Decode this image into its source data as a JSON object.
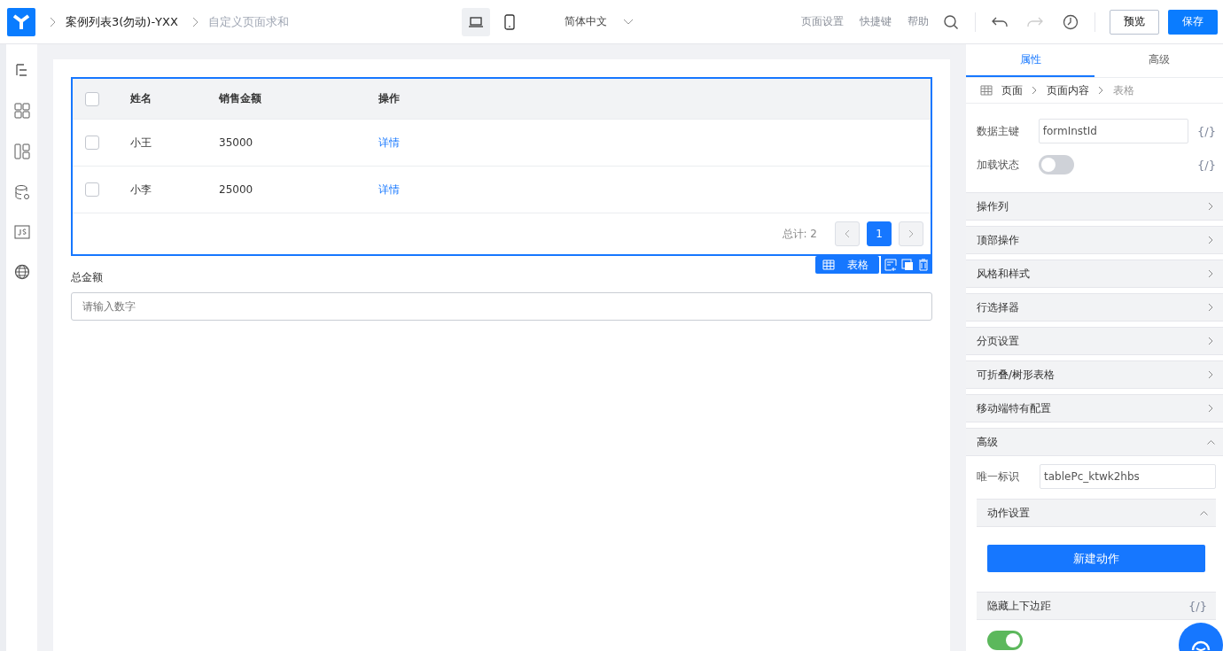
{
  "topbar": {
    "breadcrumb": [
      {
        "label": "案例列表3(勿动)-YXX",
        "current": false
      },
      {
        "label": "自定义页面求和",
        "current": true
      }
    ],
    "devices": [
      {
        "kind": "desktop",
        "selected": true
      },
      {
        "kind": "mobile",
        "selected": false
      }
    ],
    "language": "简体中文",
    "links": [
      "页面设置",
      "快捷键",
      "帮助"
    ],
    "preview": "预览",
    "save": "保存"
  },
  "table": {
    "header_checked": false,
    "columns": [
      "姓名",
      "销售金额",
      "操作"
    ],
    "rows": [
      {
        "checked": false,
        "cells": [
          "小王",
          "35000",
          "详情"
        ]
      },
      {
        "checked": false,
        "cells": [
          "小李",
          "25000",
          "详情"
        ]
      }
    ],
    "total": "总计: 2",
    "pages": [
      {
        "label": "1",
        "selected": true
      }
    ],
    "tag": "表格"
  },
  "field": {
    "label": "总金额",
    "placeholder": "请输入数字"
  },
  "panel": {
    "tabs": [
      {
        "label": "属性",
        "selected": true
      },
      {
        "label": "高级",
        "selected": false
      }
    ],
    "path": [
      {
        "label": "页面",
        "current": false
      },
      {
        "label": "页面内容",
        "current": false
      },
      {
        "label": "表格",
        "current": true
      }
    ],
    "props": [
      {
        "kind": "input",
        "label": "数据主键",
        "value": "formInstId",
        "binding": "{/}"
      },
      {
        "kind": "toggle",
        "label": "加载状态",
        "on": false,
        "binding": "{/}"
      }
    ],
    "sections": [
      {
        "title": "操作列",
        "expanded": false
      },
      {
        "title": "顶部操作",
        "expanded": false
      },
      {
        "title": "风格和样式",
        "expanded": false
      },
      {
        "title": "行选择器",
        "expanded": false
      },
      {
        "title": "分页设置",
        "expanded": false
      },
      {
        "title": "可折叠/树形表格",
        "expanded": false
      },
      {
        "title": "移动端特有配置",
        "expanded": false
      }
    ],
    "advanced": {
      "title": "高级",
      "expanded": true,
      "id_label": "唯一标识",
      "id_value": "tablePc_ktwk2hbs",
      "action": {
        "title": "动作设置",
        "expanded": true,
        "button": "新建动作"
      },
      "hide_margin": {
        "label": "隐藏上下边距",
        "binding": "{/}",
        "on": true
      }
    }
  }
}
